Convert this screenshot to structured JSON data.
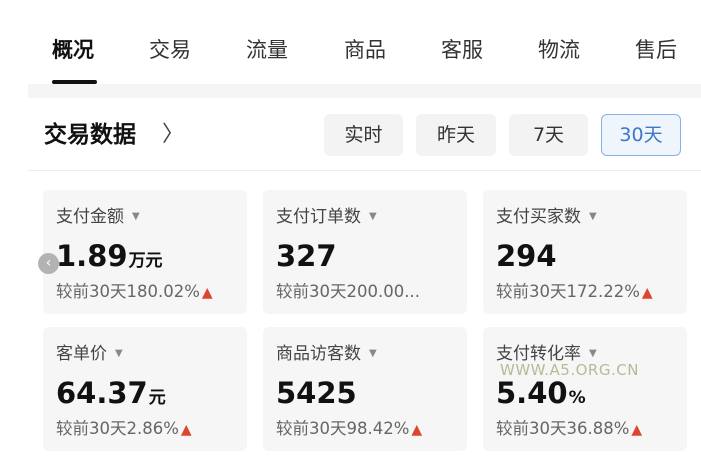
{
  "tabs": [
    "概况",
    "交易",
    "流量",
    "商品",
    "客服",
    "物流",
    "售后"
  ],
  "active_tab": "概况",
  "section": {
    "title": "交易数据",
    "chevron": "〉"
  },
  "time_ranges": [
    "实时",
    "昨天",
    "7天",
    "30天"
  ],
  "selected_range": "30天",
  "metrics": [
    {
      "label": "支付金额",
      "value": "1.89",
      "unit": "万元",
      "compare": "较前30天180.02%",
      "trend": "up"
    },
    {
      "label": "支付订单数",
      "value": "327",
      "unit": "",
      "compare": "较前30天200.00...",
      "trend": ""
    },
    {
      "label": "支付买家数",
      "value": "294",
      "unit": "",
      "compare": "较前30天172.22%",
      "trend": "up"
    },
    {
      "label": "客单价",
      "value": "64.37",
      "unit": "元",
      "compare": "较前30天2.86%",
      "trend": "up"
    },
    {
      "label": "商品访客数",
      "value": "5425",
      "unit": "",
      "compare": "较前30天98.42%",
      "trend": "up"
    },
    {
      "label": "支付转化率",
      "value": "5.40",
      "unit": "%",
      "compare": "较前30天36.88%",
      "trend": "up"
    }
  ],
  "icons": {
    "caret": "caret-down-icon",
    "trend_up": "arrow-up-icon",
    "scroll_left": "chevron-left-icon"
  },
  "colors": {
    "accent": "#3f77c5",
    "trend_up": "#d9472f",
    "card_bg": "#f6f6f6"
  },
  "watermark": "WWW.A5.ORG.CN"
}
